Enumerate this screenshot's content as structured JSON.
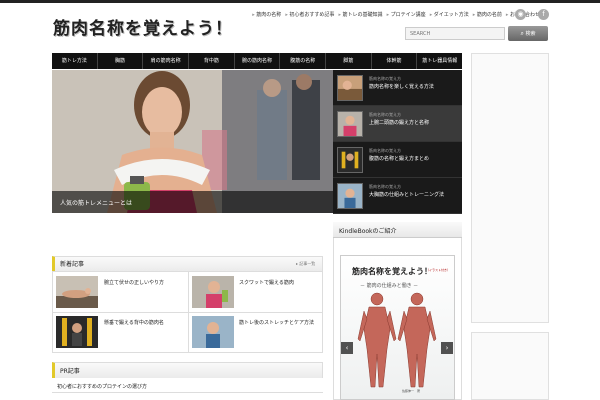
{
  "site": {
    "logo": "筋肉名称を覚えよう！"
  },
  "header_nav": {
    "items": [
      "筋肉の名称",
      "初心者おすすめ記事",
      "筋トレの基礎知識",
      "プロテイン講座",
      "ダイエット方法",
      "筋肉の名前",
      "お問い合わせ"
    ]
  },
  "social": {
    "rss_icon": "rss-icon",
    "facebook_icon": "facebook-icon"
  },
  "search": {
    "placeholder": "SEARCH",
    "button_label": "検索"
  },
  "global_nav": {
    "items": [
      "筋トレ方法",
      "胸筋",
      "肩の筋肉名称",
      "背中筋",
      "腕の筋肉名称",
      "腹筋の名称",
      "脚筋",
      "体幹筋",
      "筋トレ器具情報"
    ]
  },
  "slider": {
    "caption": "人気の筋トレメニューとは"
  },
  "side_list": {
    "items": [
      {
        "date": "筋肉名称の覚え方",
        "title": "筋肉名称を楽しく覚える方法"
      },
      {
        "date": "筋肉名称の覚え方",
        "title": "上腕二頭筋の鍛え方と名称"
      },
      {
        "date": "筋肉名称の覚え方",
        "title": "腹筋の名称と鍛え方まとめ"
      },
      {
        "date": "筋肉名称の覚え方",
        "title": "大胸筋の仕組みとトレーニング法"
      }
    ]
  },
  "kindle": {
    "heading": "KindleBookのご紹介",
    "book_title": "筋肉名称を覚えよう！",
    "book_tag": "（イラスト付き）",
    "book_subtitle": "－ 筋肉の仕組みと働き －",
    "book_author": "佐藤伸一　著"
  },
  "new_posts": {
    "heading": "新着記事",
    "more_label": "▸ 記事一覧",
    "items": [
      {
        "title": "腕立て伏せの正しいやり方"
      },
      {
        "title": "スクワットで鍛える筋肉"
      },
      {
        "title": "懸垂で鍛える背中の筋肉名"
      },
      {
        "title": "筋トレ後のストレッチとケア方法"
      }
    ]
  },
  "pr": {
    "heading": "PR記事",
    "text": "初心者におすすめのプロテインの選び方"
  },
  "colors": {
    "accent": "#e2c92a",
    "nav_bg": "#111111",
    "side_list_bg": "#1a1a1a"
  }
}
